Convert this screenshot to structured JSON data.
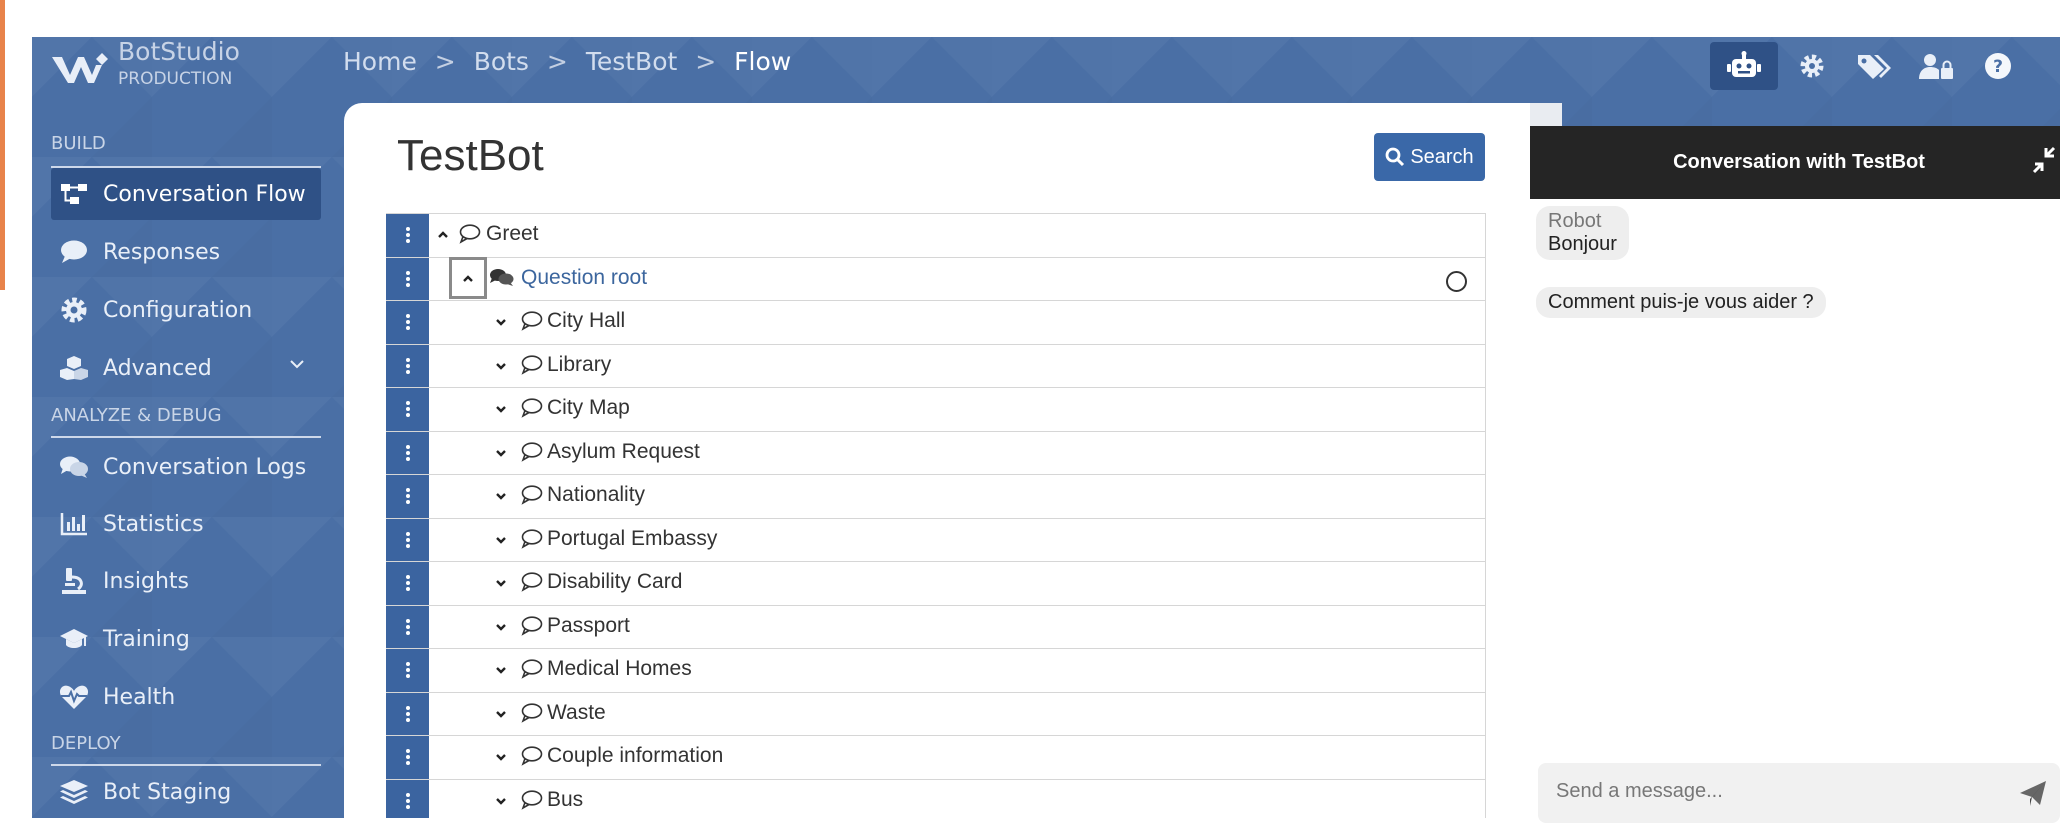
{
  "brand": {
    "name": "BotStudio",
    "environment": "PRODUCTION"
  },
  "breadcrumb": {
    "items": [
      "Home",
      "Bots",
      "TestBot"
    ],
    "current": "Flow",
    "separator": ">"
  },
  "topbar_icons": [
    "robot-icon",
    "gear-icon",
    "tags-icon",
    "user-lock-icon",
    "question-icon"
  ],
  "sidebar": {
    "sections": {
      "build": "BUILD",
      "analyze": "ANALYZE & DEBUG",
      "deploy": "DEPLOY"
    },
    "build_items": [
      {
        "label": "Conversation Flow",
        "icon": "sitemap-icon",
        "active": true
      },
      {
        "label": "Responses",
        "icon": "comment-icon"
      },
      {
        "label": "Configuration",
        "icon": "gear-icon"
      },
      {
        "label": "Advanced",
        "icon": "cubes-icon",
        "expandable": true
      }
    ],
    "analyze_items": [
      {
        "label": "Conversation Logs",
        "icon": "comments-icon"
      },
      {
        "label": "Statistics",
        "icon": "chart-bar-icon"
      },
      {
        "label": "Insights",
        "icon": "microscope-icon"
      },
      {
        "label": "Training",
        "icon": "graduation-cap-icon"
      },
      {
        "label": "Health",
        "icon": "heartbeat-icon"
      }
    ],
    "deploy_items": [
      {
        "label": "Bot Staging",
        "icon": "layers-icon"
      }
    ]
  },
  "main": {
    "title": "TestBot",
    "search_label": "Search",
    "tree": [
      {
        "label": "Greet",
        "level": 0,
        "expanded": true,
        "type": "story"
      },
      {
        "label": "Question root",
        "level": 1,
        "expanded": true,
        "type": "question",
        "link": true
      },
      {
        "label": "City Hall",
        "level": 2
      },
      {
        "label": "Library",
        "level": 2
      },
      {
        "label": "City Map",
        "level": 2
      },
      {
        "label": "Asylum Request",
        "level": 2
      },
      {
        "label": "Nationality",
        "level": 2
      },
      {
        "label": "Portugal Embassy",
        "level": 2
      },
      {
        "label": "Disability Card",
        "level": 2
      },
      {
        "label": "Passport",
        "level": 2
      },
      {
        "label": "Medical Homes",
        "level": 2
      },
      {
        "label": "Waste",
        "level": 2
      },
      {
        "label": "Couple information",
        "level": 2
      },
      {
        "label": "Bus",
        "level": 2
      }
    ]
  },
  "chat": {
    "title": "Conversation with TestBot",
    "sender": "Robot",
    "messages": [
      "Bonjour",
      "Comment puis-je vous aider ?"
    ],
    "input_placeholder": "Send a message..."
  },
  "colors": {
    "brand_blue": "#4a6fa5",
    "active_blue": "#2f5186",
    "handle_blue": "#3b64a0",
    "chat_header": "#252525",
    "link": "#3c669e"
  }
}
